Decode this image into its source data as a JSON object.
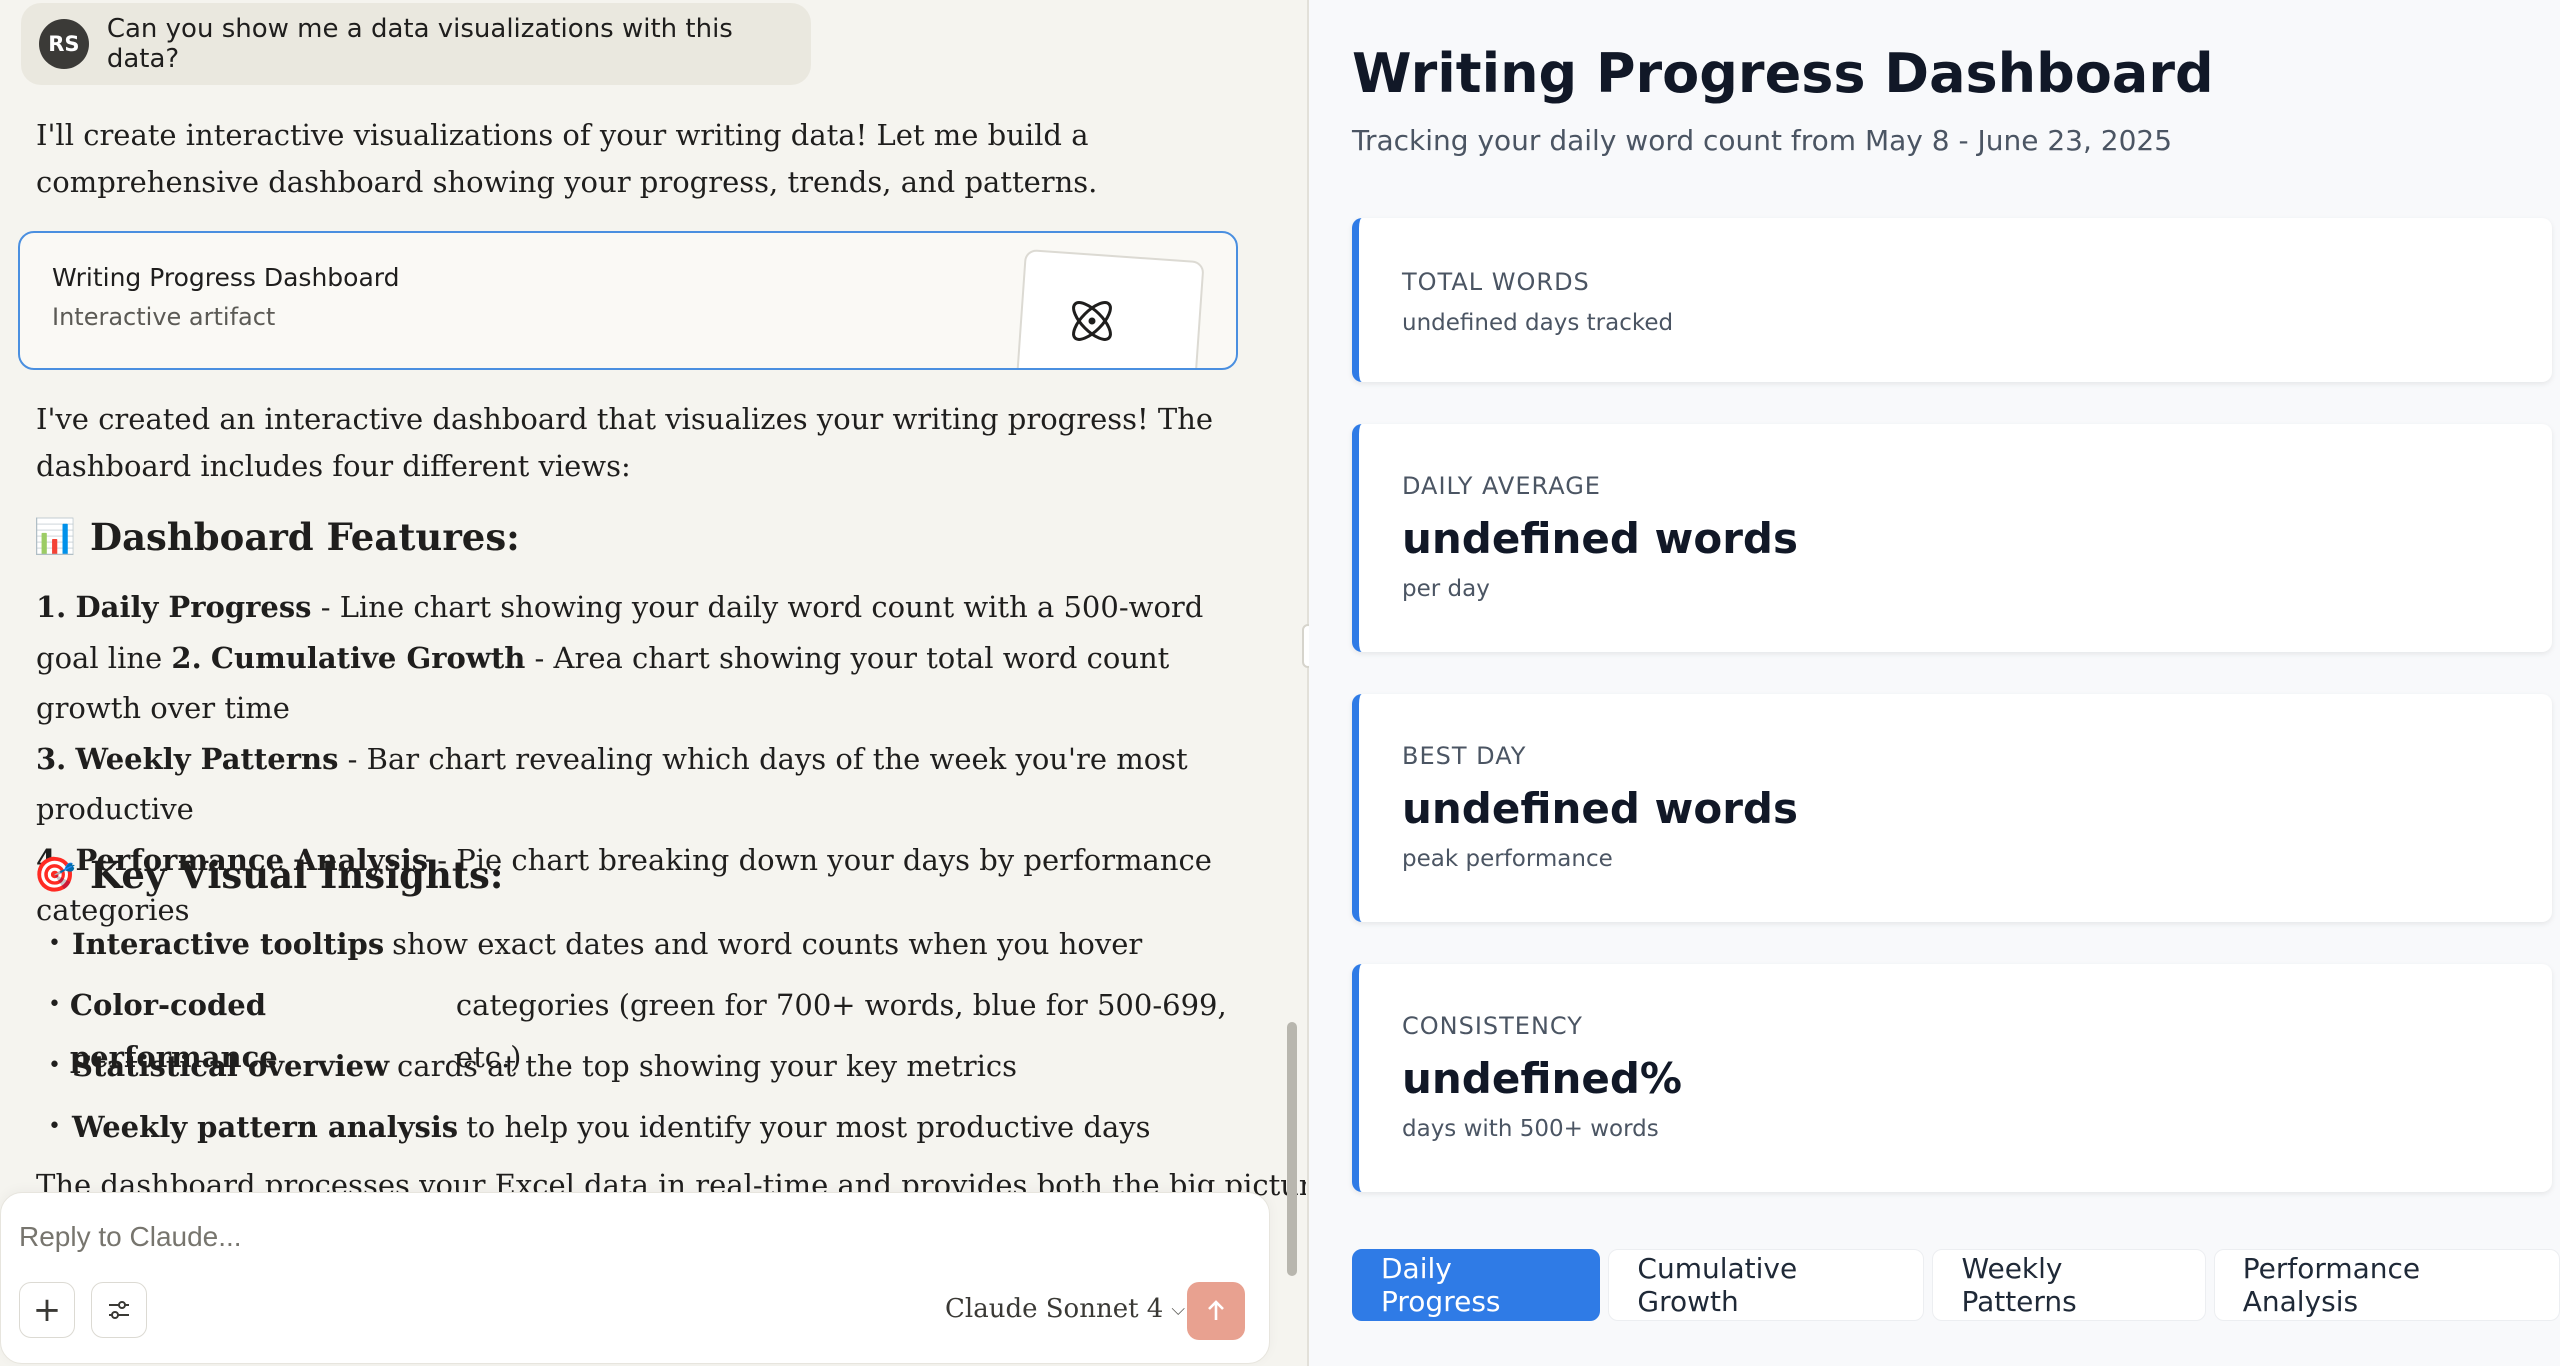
{
  "chat": {
    "user_avatar": "RS",
    "user_message": "Can you show me a data visualizations with this data?",
    "intro": "I'll create interactive visualizations of your writing data! Let me build a comprehensive dashboard showing your progress, trends, and patterns.",
    "artifact": {
      "title": "Writing Progress Dashboard",
      "subtitle": "Interactive artifact",
      "icon": "atom-icon"
    },
    "summary": "I've created an interactive dashboard that visualizes your writing progress! The dashboard includes four different views:",
    "features_heading": {
      "emoji": "📊",
      "text": "Dashboard Features:"
    },
    "features": [
      {
        "num": "1.",
        "title": "Daily Progress",
        "desc": " - Line chart showing your daily word count with a 500-word goal line "
      },
      {
        "num": "2.",
        "title": "Cumulative Growth",
        "desc": " - Area chart showing your total word count growth over time"
      },
      {
        "num": "3.",
        "title": "Weekly Patterns",
        "desc": " - Bar chart revealing which days of the week you're most productive"
      },
      {
        "num": "4.",
        "title": "Performance Analysis",
        "desc": " - Pie chart breaking down your days by performance categories"
      }
    ],
    "insights_heading": {
      "emoji": "🎯",
      "text": "Key Visual Insights:"
    },
    "insights": [
      {
        "bold": "Interactive tooltips",
        "rest": "show exact dates and word counts when you hover"
      },
      {
        "bold": "Color-coded performance",
        "rest": "categories (green for 700+ words, blue for 500-699, etc.)"
      },
      {
        "bold": "Statistical overview",
        "rest": "cards at the top showing your key metrics"
      },
      {
        "bold": "Weekly pattern analysis",
        "rest": "to help you identify your most productive days"
      }
    ],
    "cutoff_text": "The dashboard processes your Excel data in real-time and provides both the big picture",
    "composer": {
      "placeholder": "Reply to Claude...",
      "model": "Claude Sonnet 4"
    }
  },
  "dashboard": {
    "title": "Writing Progress Dashboard",
    "subtitle": "Tracking your daily word count from May 8 - June 23, 2025",
    "cards": [
      {
        "label": "Total Words",
        "value": "",
        "note": "undefined days tracked"
      },
      {
        "label": "Daily Average",
        "value": "undefined words",
        "note": "per day"
      },
      {
        "label": "Best Day",
        "value": "undefined words",
        "note": "peak performance"
      },
      {
        "label": "Consistency",
        "value": "undefined%",
        "note": "days with 500+ words"
      }
    ],
    "tabs": [
      "Daily Progress",
      "Cumulative Growth",
      "Weekly Patterns",
      "Performance Analysis"
    ],
    "active_tab": "Daily Progress"
  },
  "colors": {
    "accent": "#2f7be6",
    "send_button": "#e8a190",
    "artifact_border": "#4a8fe0"
  }
}
